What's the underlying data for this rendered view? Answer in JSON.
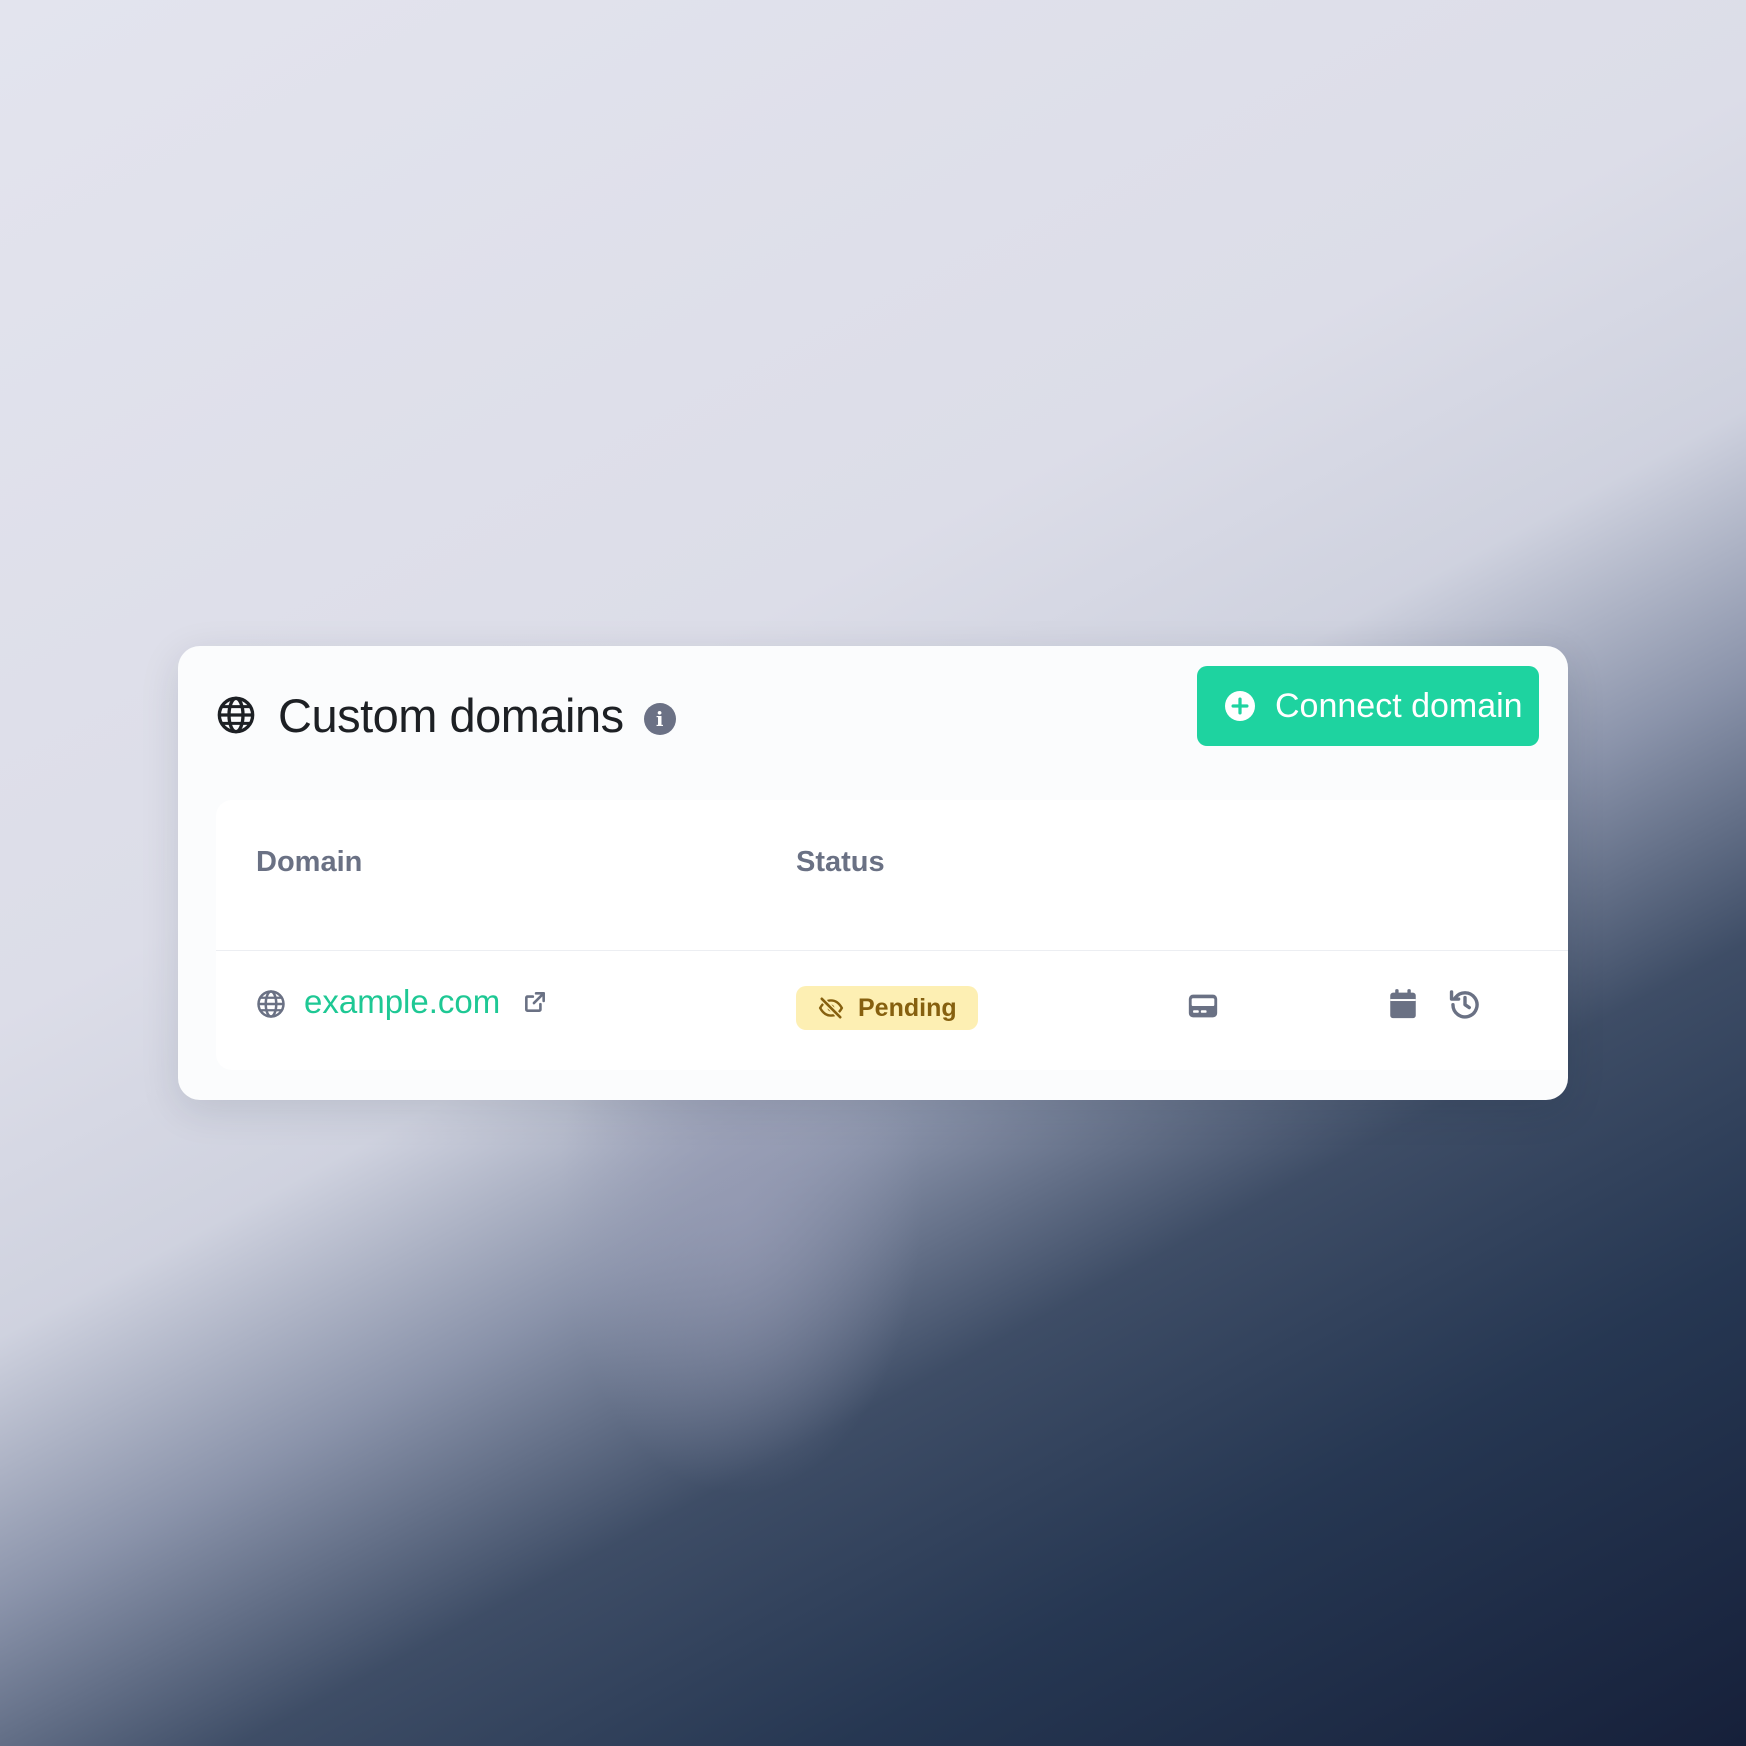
{
  "header": {
    "title": "Custom domains",
    "info_glyph": "i",
    "connect_button_label": "Connect domain"
  },
  "table": {
    "columns": [
      "Domain",
      "Status"
    ],
    "rows": [
      {
        "domain": "example.com",
        "status": "Pending",
        "actions": [
          "card-icon",
          "calendar-icon",
          "history-icon"
        ]
      }
    ]
  },
  "colors": {
    "accent": "#1ED3A0",
    "link": "#1EC894",
    "pending_bg": "#FDEFB3",
    "pending_text": "#86600F",
    "muted": "#6A7184"
  }
}
